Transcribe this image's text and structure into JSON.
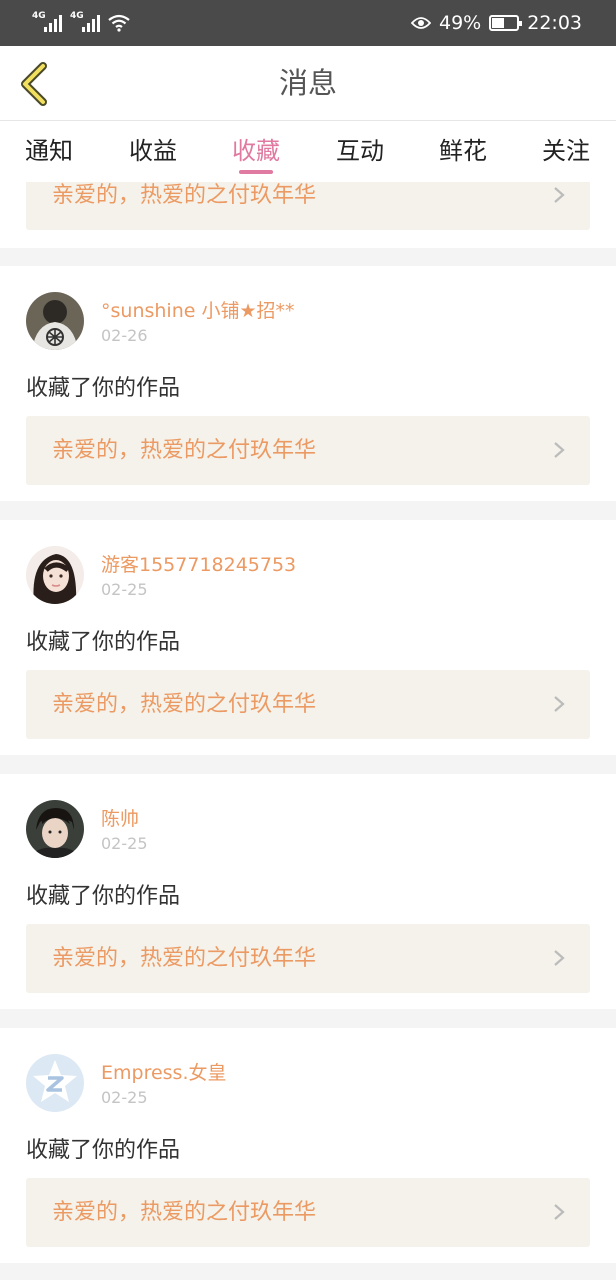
{
  "status_bar": {
    "network_left_1": "4G",
    "network_left_2": "4G",
    "battery_percent": "49%",
    "battery_level": 0.49,
    "time": "22:03"
  },
  "header": {
    "title": "消息",
    "back_icon": "chevron-left-icon"
  },
  "tabs": [
    {
      "label": "通知",
      "active": false
    },
    {
      "label": "收益",
      "active": false
    },
    {
      "label": "收藏",
      "active": true
    },
    {
      "label": "互动",
      "active": false
    },
    {
      "label": "鲜花",
      "active": false
    },
    {
      "label": "关注",
      "active": false
    }
  ],
  "colors": {
    "accent_pink": "#e07aa0",
    "username_orange": "#ec9a63",
    "work_box_bg": "#f4f2ea",
    "statusbar_bg": "#4a4a4a"
  },
  "partial_item": {
    "work_title": "亲爱的，热爱的之付玖年华"
  },
  "notifications": [
    {
      "username": "°sunshine 小铺★招**",
      "date": "02-26",
      "action": "收藏了你的作品",
      "work_title": "亲爱的，热爱的之付玖年华",
      "avatar_icon": "user-avatar"
    },
    {
      "username": "游客1557718245753",
      "date": "02-25",
      "action": "收藏了你的作品",
      "work_title": "亲爱的，热爱的之付玖年华",
      "avatar_icon": "user-avatar"
    },
    {
      "username": "陈帅",
      "date": "02-25",
      "action": "收藏了你的作品",
      "work_title": "亲爱的，热爱的之付玖年华",
      "avatar_icon": "user-avatar"
    },
    {
      "username": "Empress.女皇",
      "date": "02-25",
      "action": "收藏了你的作品",
      "work_title": "亲爱的，热爱的之付玖年华",
      "avatar_icon": "qzone-default-avatar"
    }
  ]
}
